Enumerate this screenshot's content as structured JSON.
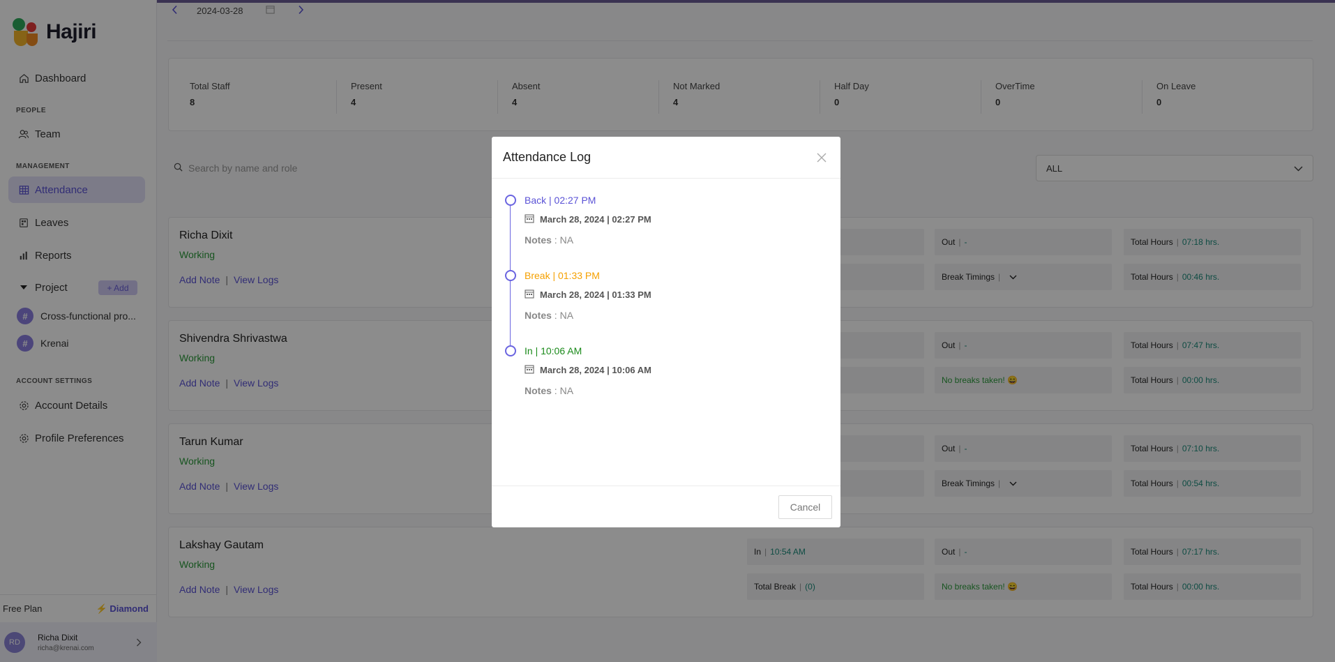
{
  "app": {
    "name": "Hajiri"
  },
  "colors": {
    "accent": "#5a52d6",
    "working": "#2a9a3a",
    "break": "#f5a000",
    "in": "#1a8a1a",
    "back": "#5a52d6"
  },
  "sidebar": {
    "dashboard": "Dashboard",
    "people_section": "PEOPLE",
    "team": "Team",
    "management_section": "MANAGEMENT",
    "attendance": "Attendance",
    "leaves": "Leaves",
    "reports": "Reports",
    "project": "Project",
    "add_label": "+ Add",
    "projects": [
      "Cross-functional pro...",
      "Krenai"
    ],
    "account_section": "ACCOUNT SETTINGS",
    "account_details": "Account Details",
    "profile_preferences": "Profile Preferences",
    "plan": "Free Plan",
    "plan_tier": "Diamond",
    "user": {
      "initials": "RD",
      "name": "Richa Dixit",
      "email": "richa@krenai.com"
    }
  },
  "datebar": {
    "date": "2024-03-28"
  },
  "stats": [
    {
      "label": "Total Staff",
      "value": "8"
    },
    {
      "label": "Present",
      "value": "4"
    },
    {
      "label": "Absent",
      "value": "4"
    },
    {
      "label": "Not Marked",
      "value": "4"
    },
    {
      "label": "Half Day",
      "value": "0"
    },
    {
      "label": "OverTime",
      "value": "0"
    },
    {
      "label": "On Leave",
      "value": "0"
    }
  ],
  "search": {
    "placeholder": "Search by name and role"
  },
  "filter": {
    "value": "ALL"
  },
  "links": {
    "add_note": "Add Note",
    "separator": "|",
    "view_logs": "View Logs"
  },
  "labels": {
    "in": "In",
    "out": "Out",
    "total_hours": "Total Hours",
    "break_timings": "Break Timings",
    "total_break": "Total Break",
    "no_breaks": "No breaks taken! 😄"
  },
  "staff": [
    {
      "name": "Richa Dixit",
      "status": "Working",
      "out": "-",
      "total1": "07:18 hrs.",
      "total2": "00:46 hrs."
    },
    {
      "name": "Shivendra Shrivastwa",
      "status": "Working",
      "out": "-",
      "total1": "07:47 hrs.",
      "total2": "00:00 hrs."
    },
    {
      "name": "Tarun Kumar",
      "status": "Working",
      "out": "-",
      "total1": "07:10 hrs.",
      "total2": "00:54 hrs."
    },
    {
      "name": "Lakshay Gautam",
      "status": "Working",
      "in": "10:54 AM",
      "out": "-",
      "total_break": "(0)",
      "total1": "07:17 hrs.",
      "total2": "00:00 hrs."
    }
  ],
  "modal": {
    "title": "Attendance Log",
    "cancel": "Cancel",
    "notes_label": "Notes",
    "notes_sep": ":",
    "entries": [
      {
        "heading": "Back | 02:27 PM",
        "date": "March 28, 2024 | 02:27 PM",
        "notes": "NA"
      },
      {
        "heading": "Break | 01:33 PM",
        "date": "March 28, 2024 | 01:33 PM",
        "notes": "NA"
      },
      {
        "heading": "In | 10:06 AM",
        "date": "March 28, 2024 | 10:06 AM",
        "notes": "NA"
      }
    ]
  }
}
